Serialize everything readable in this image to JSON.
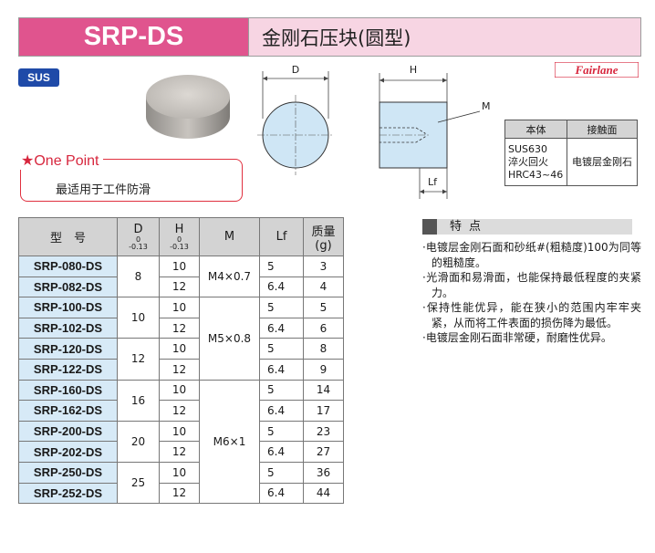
{
  "header": {
    "model": "SRP-DS",
    "name": "金刚石压块(圆型)"
  },
  "material_badge": "SUS",
  "brand": "Fairlane",
  "one_point": {
    "title": "★One Point",
    "text": "最适用于工件防滑"
  },
  "drawing": {
    "label_d": "D",
    "label_h": "H",
    "label_m": "M",
    "label_lf": "Lf"
  },
  "material_table": {
    "headers": [
      "本体",
      "接触面"
    ],
    "body": [
      "SUS630",
      "淬火回火",
      "HRC43~46"
    ],
    "surface": "电镀层金刚石"
  },
  "spec_table": {
    "headers": {
      "model": "型　号",
      "d": "D",
      "d_tol_upper": "0",
      "d_tol_lower": "-0.13",
      "h": "H",
      "h_tol_upper": "0",
      "h_tol_lower": "-0.13",
      "m": "M",
      "lf": "Lf",
      "mass": "质量",
      "mass_unit": "(g)"
    },
    "rows": [
      {
        "model": "SRP-080-DS",
        "d": "8",
        "h": "10",
        "m": "M4×0.7",
        "lf": "5",
        "mass": "3"
      },
      {
        "model": "SRP-082-DS",
        "h": "12",
        "lf": "6.4",
        "mass": "4"
      },
      {
        "model": "SRP-100-DS",
        "d": "10",
        "h": "10",
        "m": "M5×0.8",
        "lf": "5",
        "mass": "5"
      },
      {
        "model": "SRP-102-DS",
        "h": "12",
        "lf": "6.4",
        "mass": "6"
      },
      {
        "model": "SRP-120-DS",
        "d": "12",
        "h": "10",
        "lf": "5",
        "mass": "8"
      },
      {
        "model": "SRP-122-DS",
        "h": "12",
        "lf": "6.4",
        "mass": "9"
      },
      {
        "model": "SRP-160-DS",
        "d": "16",
        "h": "10",
        "m": "M6×1",
        "lf": "5",
        "mass": "14"
      },
      {
        "model": "SRP-162-DS",
        "h": "12",
        "lf": "6.4",
        "mass": "17"
      },
      {
        "model": "SRP-200-DS",
        "d": "20",
        "h": "10",
        "lf": "5",
        "mass": "23"
      },
      {
        "model": "SRP-202-DS",
        "h": "12",
        "lf": "6.4",
        "mass": "27"
      },
      {
        "model": "SRP-250-DS",
        "d": "25",
        "h": "10",
        "lf": "5",
        "mass": "36"
      },
      {
        "model": "SRP-252-DS",
        "h": "12",
        "lf": "6.4",
        "mass": "44"
      }
    ]
  },
  "features": {
    "title": "特点",
    "items": [
      "·电镀层金刚石面和砂纸#(粗糙度)100为同等的粗糙度。",
      "·光滑面和易滑面，也能保持最低程度的夹紧力。",
      "·保持性能优异，能在狭小的范围内牢牢夹紧，从而将工件表面的损伤降为最低。",
      "·电镀层金刚石面非常硬，耐磨性优异。"
    ]
  },
  "colors": {
    "brand_pink": "#e0548e",
    "light_pink": "#f7d5e3",
    "sus_blue": "#1f4aa8",
    "part_blue": "#cfe6f5",
    "model_cell": "#d7eaf7",
    "brand_red": "#d7263d"
  }
}
